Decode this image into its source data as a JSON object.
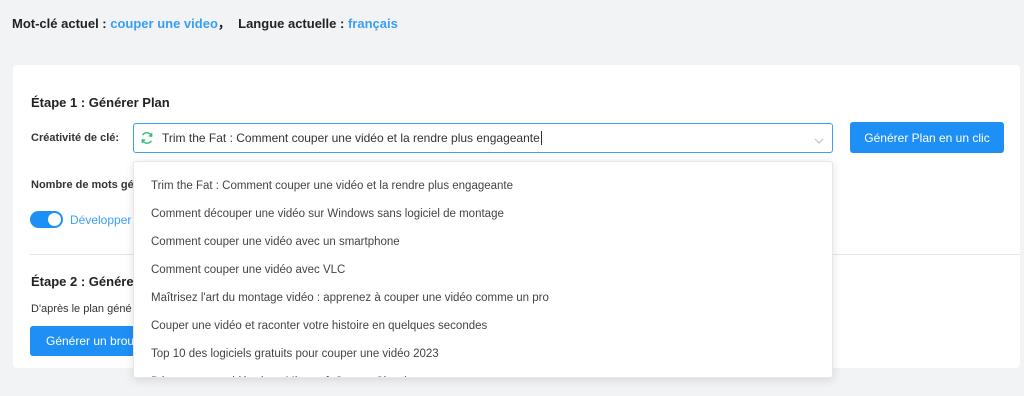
{
  "header": {
    "keyword_label": "Mot-clé actuel :",
    "keyword_value": "couper une video",
    "separator": "，",
    "language_label": "Langue actuelle :",
    "language_value": "français"
  },
  "step1": {
    "title": "Étape 1 : Générer Plan",
    "creativity_label": "Créativité de clé:",
    "selected_title": "Trim the Fat : Comment couper une vidéo et la rendre plus engageante",
    "generate_button": "Générer Plan en un clic",
    "word_count_label": "Nombre de mots gé",
    "toggle_label": "Développer"
  },
  "step2": {
    "title": "Étape 2 : Génére",
    "description": "D'après le plan géné",
    "button": "Générer un broui"
  },
  "dropdown": {
    "options": [
      "Trim the Fat : Comment couper une vidéo et la rendre plus engageante",
      "Comment découper une vidéo sur Windows sans logiciel de montage",
      "Comment couper une vidéo avec un smartphone",
      "Comment couper une vidéo avec VLC",
      "Maîtrisez l'art du montage vidéo : apprenez à couper une vidéo comme un pro",
      "Couper une vidéo et raconter votre histoire en quelques secondes",
      "Top 10 des logiciels gratuits pour couper une vidéo 2023",
      "Découper une vidéo dans Microsoft Stream Classic"
    ]
  },
  "colors": {
    "accent": "#1e90f5",
    "link": "#3a9ff5",
    "refresh_icon": "#2fbf71"
  },
  "icons": {
    "refresh": "refresh-icon",
    "caret": "chevron-down-icon"
  }
}
